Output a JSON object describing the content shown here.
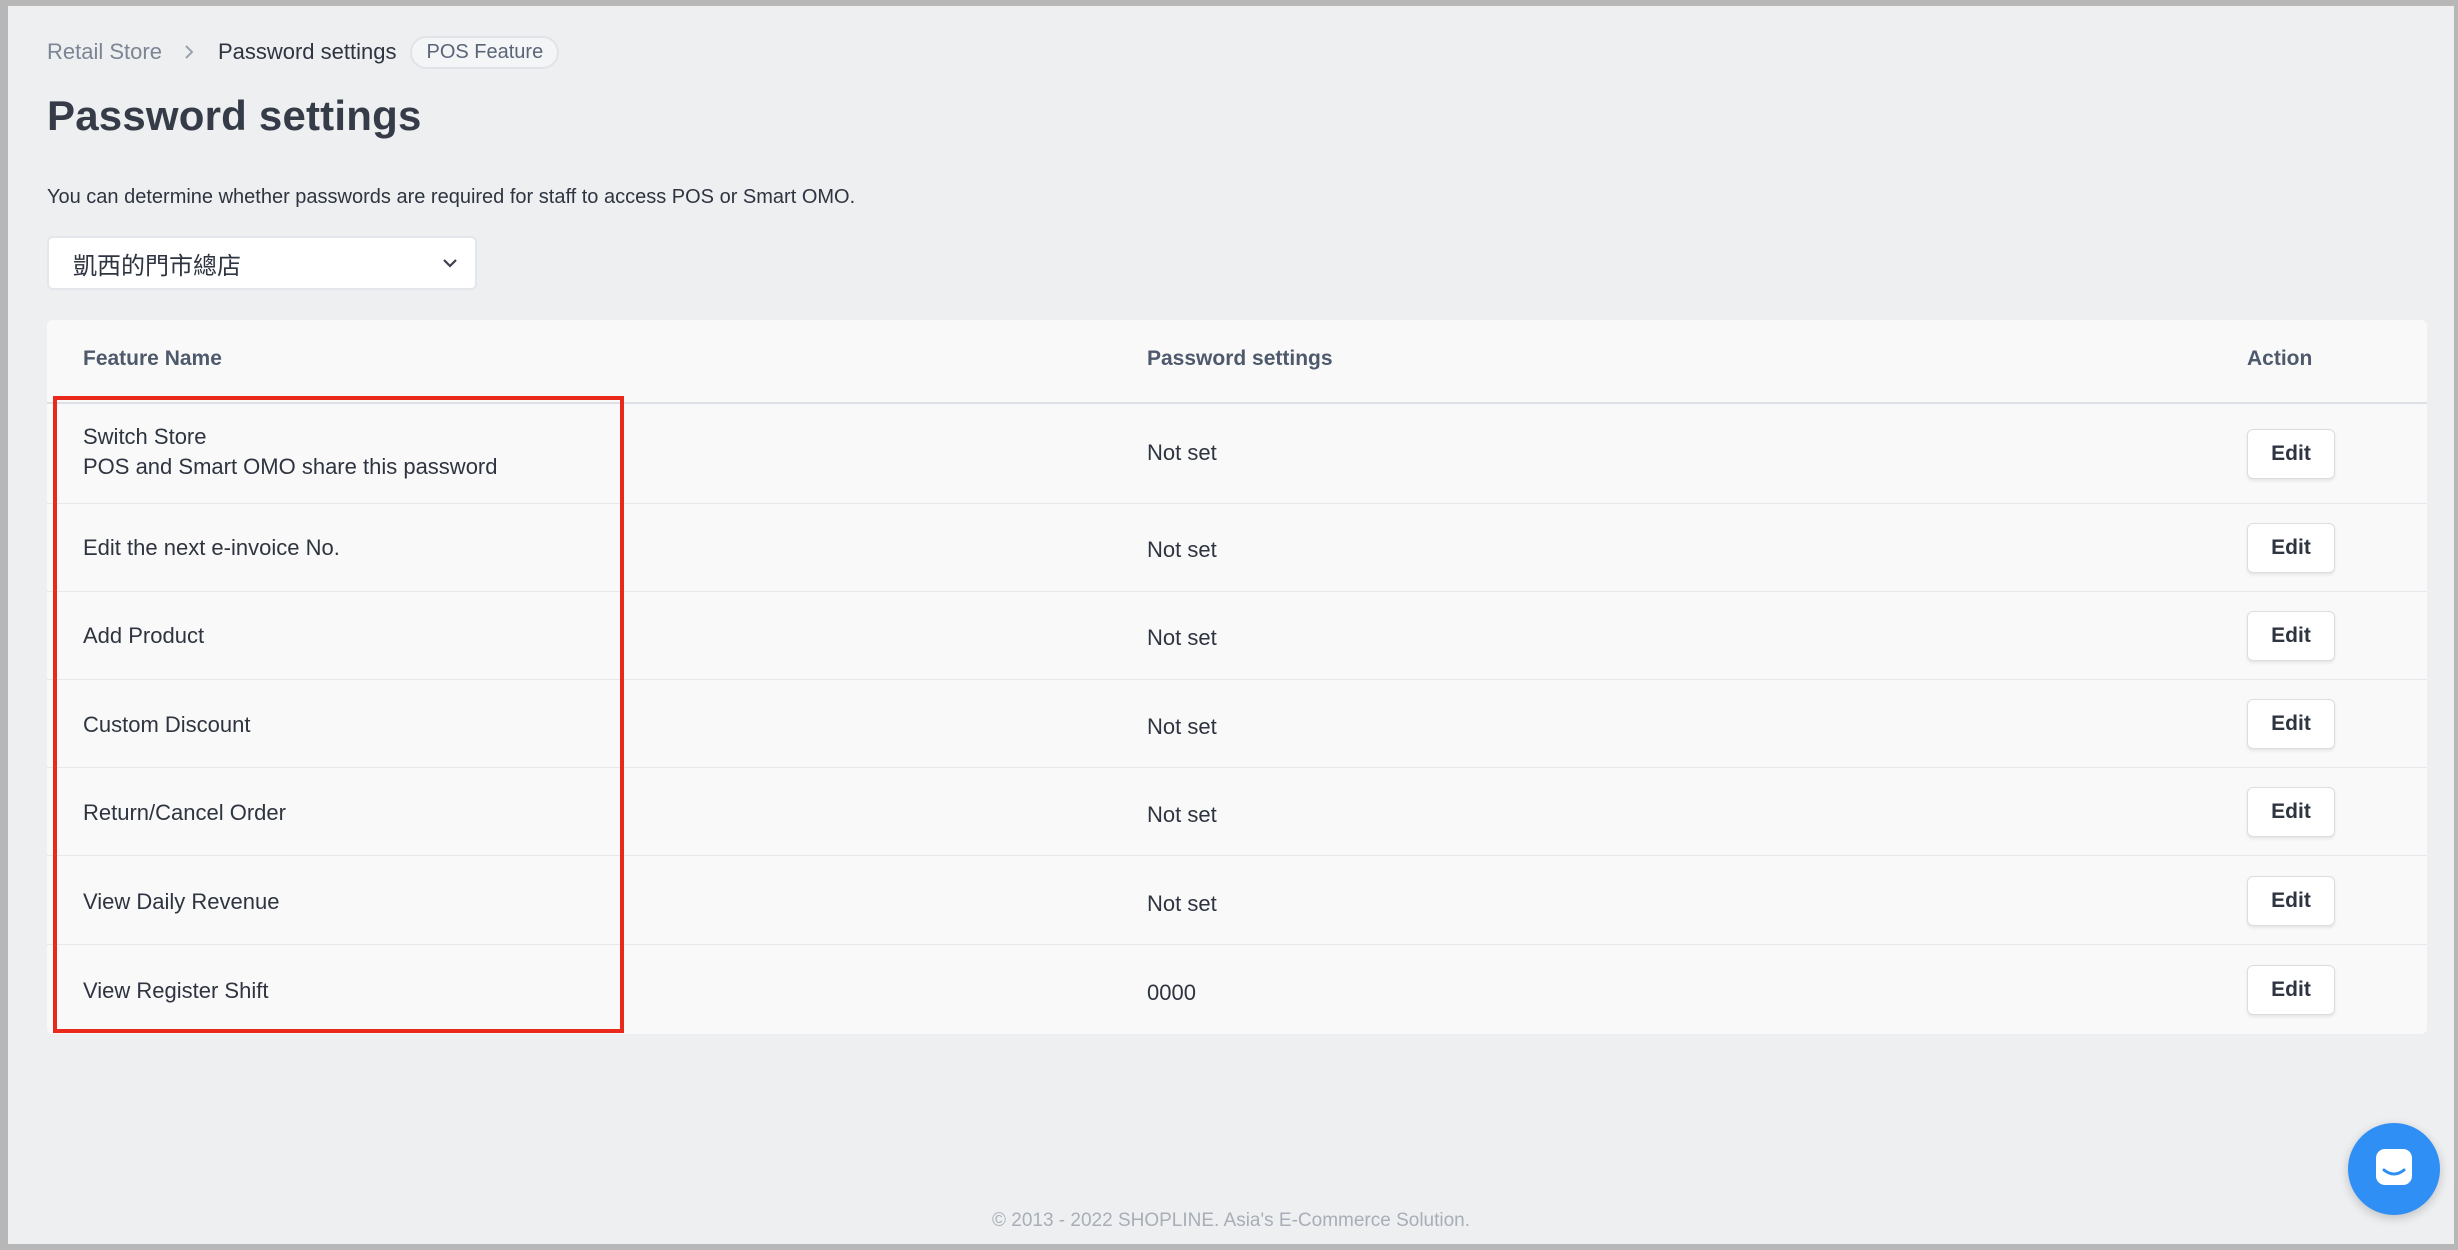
{
  "breadcrumb": {
    "parent": "Retail Store",
    "current": "Password settings",
    "badge": "POS Feature"
  },
  "page": {
    "title": "Password settings",
    "description": "You can determine whether passwords are required for staff to access POS or Smart OMO."
  },
  "store_select": {
    "value": "凱西的門市總店"
  },
  "table": {
    "headers": {
      "feature": "Feature Name",
      "password": "Password settings",
      "action": "Action"
    },
    "rows": [
      {
        "feature": "Switch Store",
        "note": "POS and Smart OMO share this password",
        "password": "Not set",
        "action": "Edit"
      },
      {
        "feature": "Edit the next e-invoice No.",
        "password": "Not set",
        "action": "Edit"
      },
      {
        "feature": "Add Product",
        "password": "Not set",
        "action": "Edit"
      },
      {
        "feature": "Custom Discount",
        "password": "Not set",
        "action": "Edit"
      },
      {
        "feature": "Return/Cancel Order",
        "password": "Not set",
        "action": "Edit"
      },
      {
        "feature": "View Daily Revenue",
        "password": "Not set",
        "action": "Edit"
      },
      {
        "feature": "View Register Shift",
        "password": "0000",
        "action": "Edit"
      }
    ]
  },
  "footer": {
    "text": "© 2013 - 2022 SHOPLINE. Asia's E-Commerce Solution."
  },
  "icons": {
    "breadcrumb_separator": "chevron-right-icon",
    "select": "chevron-down-icon",
    "chat": "chat-icon"
  },
  "colors": {
    "highlight": "#e8291c",
    "chat_button": "#2f8ff5",
    "background": "#eeeff1"
  }
}
